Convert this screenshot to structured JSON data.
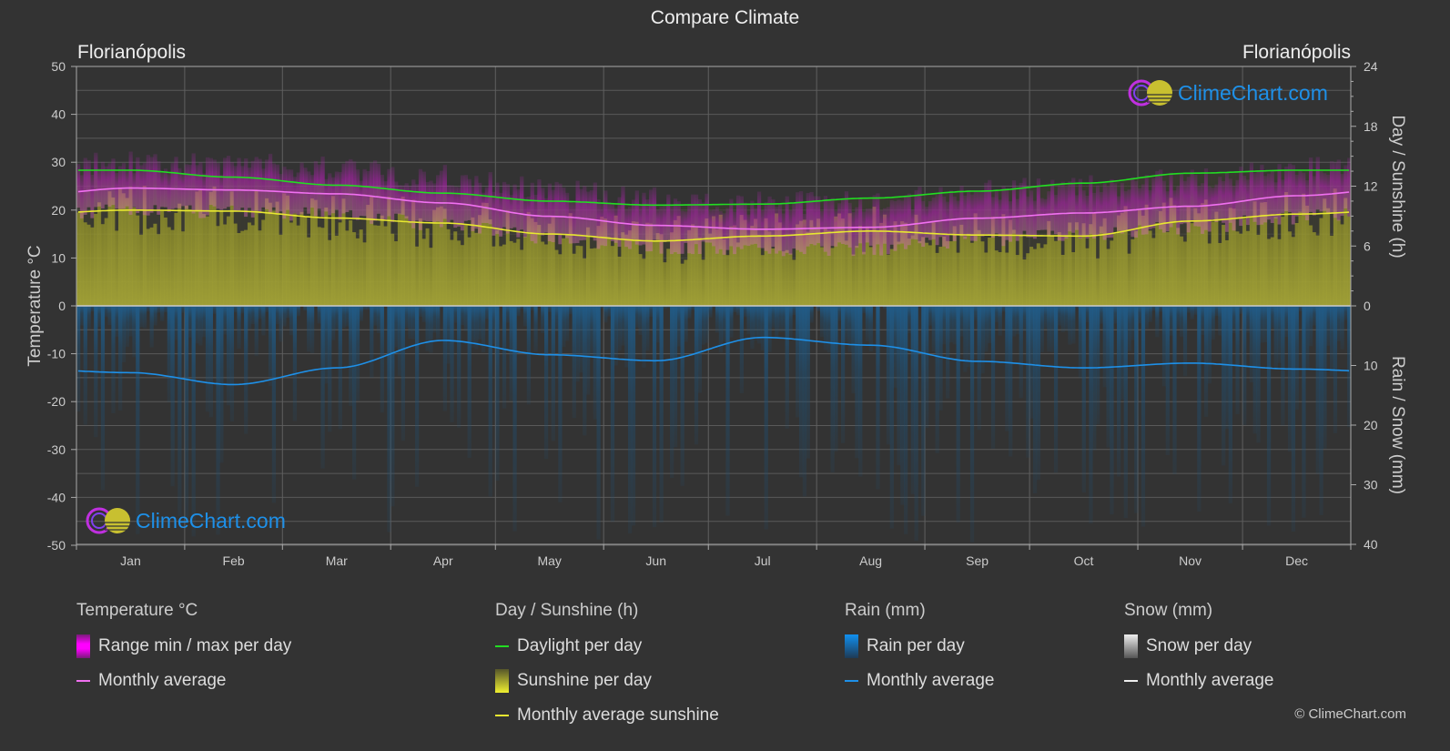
{
  "header": {
    "title": "Compare Climate",
    "city_left": "Florianópolis",
    "city_right": "Florianópolis"
  },
  "logo_text": "ClimeChart.com",
  "copyright": "© ClimeChart.com",
  "colors": {
    "background": "#333333",
    "temp_range": "#e020e0",
    "temp_avg": "#f070f0",
    "daylight": "#22dd22",
    "sunshine_fill": "#a0a030",
    "sunshine_avg": "#e8e830",
    "rain_fill": "#1f5f8f",
    "rain_avg": "#1e90e8",
    "snow": "#ffffff"
  },
  "chart_data": {
    "type": "line",
    "title": "Compare Climate",
    "categories": [
      "Jan",
      "Feb",
      "Mar",
      "Apr",
      "May",
      "Jun",
      "Jul",
      "Aug",
      "Sep",
      "Oct",
      "Nov",
      "Dec"
    ],
    "axes": {
      "left": {
        "label": "Temperature °C",
        "range": [
          -50,
          50
        ],
        "ticks": [
          50,
          40,
          30,
          20,
          10,
          0,
          -10,
          -20,
          -30,
          -40,
          -50
        ]
      },
      "right_top": {
        "label": "Day / Sunshine (h)",
        "range": [
          0,
          24
        ],
        "ticks": [
          24,
          18,
          12,
          6,
          0
        ]
      },
      "right_bottom": {
        "label": "Rain / Snow (mm)",
        "range": [
          0,
          40
        ],
        "ticks": [
          0,
          10,
          20,
          30,
          40
        ]
      }
    },
    "grid": true,
    "series": [
      {
        "name": "Temperature monthly average (°C)",
        "axis": "left",
        "values": [
          24.6,
          24.2,
          23.4,
          21.5,
          18.7,
          16.8,
          16.0,
          16.4,
          18.3,
          19.4,
          20.8,
          23.0
        ]
      },
      {
        "name": "Daylight per day (h)",
        "axis": "right_top",
        "values": [
          13.6,
          12.9,
          12.1,
          11.3,
          10.5,
          10.1,
          10.2,
          10.8,
          11.5,
          12.3,
          13.3,
          13.6
        ]
      },
      {
        "name": "Monthly average sunshine (h)",
        "axis": "right_top",
        "values": [
          9.6,
          9.5,
          8.8,
          8.3,
          7.2,
          6.5,
          7.0,
          7.5,
          7.1,
          7.0,
          8.5,
          9.2
        ]
      },
      {
        "name": "Rain monthly average (mm)",
        "axis": "right_bottom",
        "values": [
          11.2,
          13.2,
          10.4,
          5.8,
          8.2,
          9.2,
          5.3,
          6.6,
          9.3,
          10.4,
          9.6,
          10.6
        ]
      }
    ],
    "legend_position": "bottom"
  },
  "legend": {
    "groups": [
      {
        "title": "Temperature °C",
        "items": [
          {
            "label": "Range min / max per day",
            "kind": "swatch"
          },
          {
            "label": "Monthly average",
            "kind": "line"
          }
        ]
      },
      {
        "title": "Day / Sunshine (h)",
        "items": [
          {
            "label": "Daylight per day",
            "kind": "line"
          },
          {
            "label": "Sunshine per day",
            "kind": "swatch"
          },
          {
            "label": "Monthly average sunshine",
            "kind": "line"
          }
        ]
      },
      {
        "title": "Rain (mm)",
        "items": [
          {
            "label": "Rain per day",
            "kind": "swatch"
          },
          {
            "label": "Monthly average",
            "kind": "line"
          }
        ]
      },
      {
        "title": "Snow (mm)",
        "items": [
          {
            "label": "Snow per day",
            "kind": "swatch"
          },
          {
            "label": "Monthly average",
            "kind": "line"
          }
        ]
      }
    ]
  }
}
